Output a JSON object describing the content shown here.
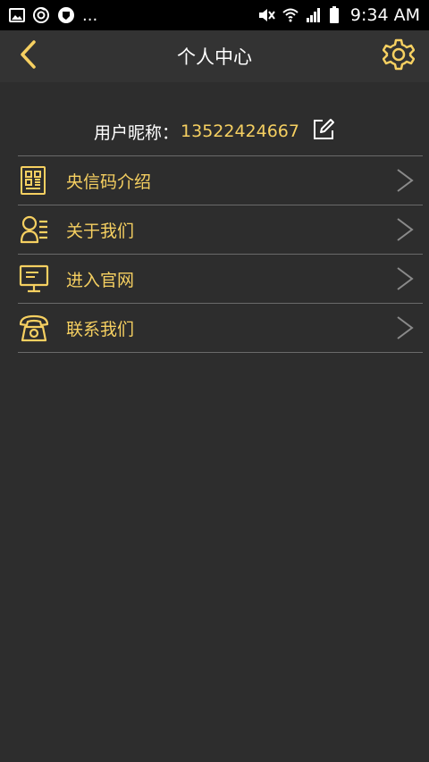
{
  "status_bar": {
    "time": "9:34 AM",
    "overflow": "...",
    "icons": [
      "image-icon",
      "sync-icon",
      "shield-icon",
      "mute-icon",
      "wifi-icon",
      "signal-icon",
      "battery-icon"
    ]
  },
  "header": {
    "title": "个人中心",
    "back_icon": "chevron-left-icon",
    "settings_icon": "gear-icon"
  },
  "profile": {
    "label": "用户昵称：",
    "value": "13522424667",
    "edit_icon": "edit-icon"
  },
  "menu": {
    "items": [
      {
        "label": "央信码介绍",
        "icon": "qr-code-icon"
      },
      {
        "label": "关于我们",
        "icon": "people-icon"
      },
      {
        "label": "进入官网",
        "icon": "monitor-icon"
      },
      {
        "label": "联系我们",
        "icon": "phone-icon"
      }
    ]
  },
  "colors": {
    "accent": "#f6d061",
    "background": "#2d2d2d",
    "header_bg": "#333333",
    "divider": "#6a6a6a",
    "chevron": "#8a8a8a"
  }
}
